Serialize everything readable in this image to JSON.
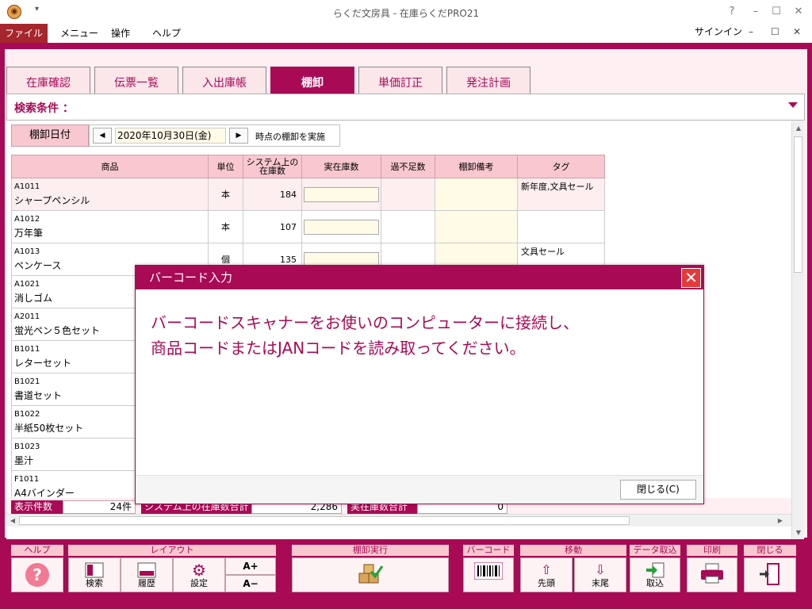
{
  "window": {
    "title": "らくだ文房具 - 在庫らくだPRO21",
    "help_glyph": "?",
    "min_glyph": "–",
    "max_glyph": "☐",
    "close_glyph": "✕"
  },
  "menu": {
    "items": [
      "ファイル",
      "メニュー",
      "操作",
      "ヘルプ"
    ],
    "signin": "サインイン"
  },
  "tabs": [
    "在庫確認",
    "伝票一覧",
    "入出庫帳",
    "棚卸",
    "単価訂正",
    "発注計画"
  ],
  "active_tab": "棚卸",
  "search": {
    "label": "検索条件 ："
  },
  "inventory": {
    "date_label": "棚卸日付",
    "date_value": "2020年10月30日(金)",
    "date_suffix": "時点の棚卸を実施",
    "prev": "◀",
    "next": "▶"
  },
  "table": {
    "headers": [
      "商品",
      "単位",
      "システム上の在庫数",
      "実在庫数",
      "過不足数",
      "棚卸備考",
      "タグ"
    ],
    "rows": [
      {
        "code": "A1011",
        "name": "シャープペンシル",
        "unit": "本",
        "system_qty": "184",
        "tag": "新年度,文具セール"
      },
      {
        "code": "A1012",
        "name": "万年筆",
        "unit": "本",
        "system_qty": "107",
        "tag": ""
      },
      {
        "code": "A1013",
        "name": "ペンケース",
        "unit": "個",
        "system_qty": "135",
        "tag": "文具セール"
      },
      {
        "code": "A1021",
        "name": "消しゴム",
        "unit": "",
        "system_qty": "",
        "tag": ""
      },
      {
        "code": "A2011",
        "name": "蛍光ペン５色セット",
        "unit": "",
        "system_qty": "",
        "tag": ""
      },
      {
        "code": "B1011",
        "name": "レターセット",
        "unit": "",
        "system_qty": "",
        "tag": ""
      },
      {
        "code": "B1021",
        "name": "書道セット",
        "unit": "",
        "system_qty": "",
        "tag": ""
      },
      {
        "code": "B1022",
        "name": "半紙50枚セット",
        "unit": "",
        "system_qty": "",
        "tag": ""
      },
      {
        "code": "B1023",
        "name": "墨汁",
        "unit": "",
        "system_qty": "",
        "tag": ""
      },
      {
        "code": "F1011",
        "name": "A4バインダー",
        "unit": "",
        "system_qty": "",
        "tag": ""
      }
    ]
  },
  "footer": {
    "count_label": "表示件数",
    "count_value": "24件",
    "sys_total_label": "システム上の在庫数合計",
    "sys_total_value": "2,286",
    "real_total_label": "実在庫数合計",
    "real_total_value": "0"
  },
  "toolbar": {
    "groups": {
      "help": "ヘルプ",
      "layout": "レイアウト",
      "execute": "棚卸実行",
      "barcode": "バーコード",
      "move": "移動",
      "import": "データ取込",
      "print": "印刷",
      "close": "閉じる"
    },
    "buttons": {
      "search": "検索",
      "history": "履歴",
      "settings": "設定",
      "font_up": "A+",
      "font_down": "A−",
      "first": "先頭",
      "last": "末尾",
      "import": "取込"
    },
    "help_glyph": "?"
  },
  "dialog": {
    "title": "バーコード入力",
    "message_line1": "バーコードスキャナーをお使いのコンピューターに接続し、",
    "message_line2": "商品コードまたはJANコードを読み取ってください。",
    "close_button": "閉じる(C)",
    "close_glyph": "✕"
  },
  "colors": {
    "accent": "#a80a55",
    "header_pink": "#f8c7cf",
    "input_yellow": "#fffbe6",
    "file_menu": "#a5262c"
  }
}
